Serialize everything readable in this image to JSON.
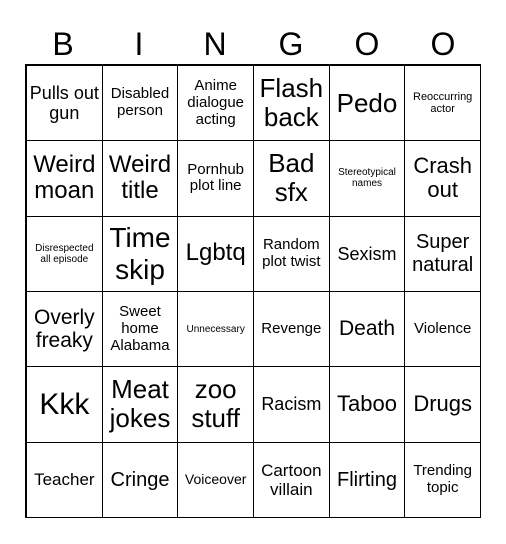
{
  "header": [
    "B",
    "I",
    "N",
    "G",
    "O",
    "O"
  ],
  "cells": [
    "Pulls out gun",
    "Disabled person",
    "Anime dialogue acting",
    "Flash back",
    "Pedo",
    "Reoccurring actor",
    "Weird moan",
    "Weird title",
    "Pornhub plot line",
    "Bad sfx",
    "Stereotypical names",
    "Crash out",
    "Disrespected all episode",
    "Time skip",
    "Lgbtq",
    "Random plot twist",
    "Sexism",
    "Super natural",
    "Overly freaky",
    "Sweet home Alabama",
    "Unnecessary",
    "Revenge",
    "Death",
    "Violence",
    "Kkk",
    "Meat jokes",
    "zoo stuff",
    "Racism",
    "Taboo",
    "Drugs",
    "Teacher",
    "Cringe",
    "Voiceover",
    "Cartoon villain",
    "Flirting",
    "Trending topic"
  ]
}
